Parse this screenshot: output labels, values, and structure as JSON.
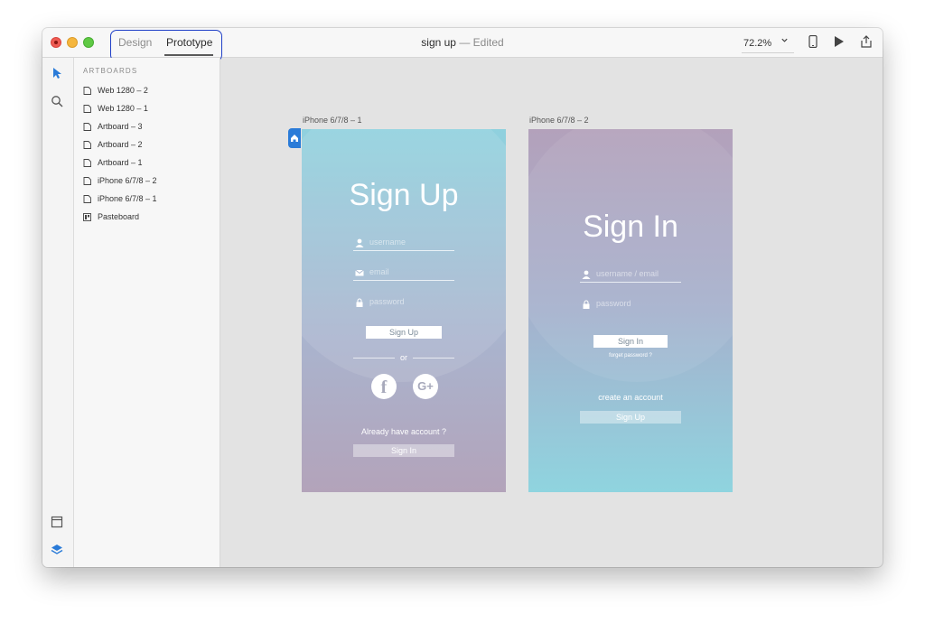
{
  "toolbar": {
    "tabs": [
      {
        "label": "Design"
      },
      {
        "label": "Prototype"
      }
    ],
    "doc_title": "sign up",
    "doc_sep": "—",
    "doc_status": "Edited",
    "zoom": "72.2%"
  },
  "layers": {
    "header": "ARTBOARDS",
    "items": [
      {
        "label": "Web 1280 – 2",
        "icon": "artboard-icon"
      },
      {
        "label": "Web 1280 – 1",
        "icon": "artboard-icon"
      },
      {
        "label": "Artboard – 3",
        "icon": "artboard-icon"
      },
      {
        "label": "Artboard – 2",
        "icon": "artboard-icon"
      },
      {
        "label": "Artboard – 1",
        "icon": "artboard-icon"
      },
      {
        "label": "iPhone 6/7/8 – 2",
        "icon": "artboard-icon"
      },
      {
        "label": "iPhone 6/7/8 – 1",
        "icon": "artboard-icon"
      },
      {
        "label": "Pasteboard",
        "icon": "pasteboard-icon"
      }
    ]
  },
  "artboards": {
    "signup": {
      "label": "iPhone 6/7/8 – 1",
      "title": "Sign Up",
      "username_ph": "username",
      "email_ph": "email",
      "password_ph": "password",
      "signup_btn": "Sign Up",
      "or": "or",
      "facebook": "f",
      "google": "G+",
      "already": "Already have account ?",
      "signin_btn": "Sign In"
    },
    "signin": {
      "label": "iPhone 6/7/8 – 2",
      "title": "Sign In",
      "username_ph": "username / email",
      "password_ph": "password",
      "signin_btn": "Sign In",
      "forgot": "forget password ?",
      "create": "create an account",
      "signup_btn": "Sign Up"
    }
  },
  "colors": {
    "accent": "#2a7bd8",
    "highlight": "#1f3fc7"
  }
}
